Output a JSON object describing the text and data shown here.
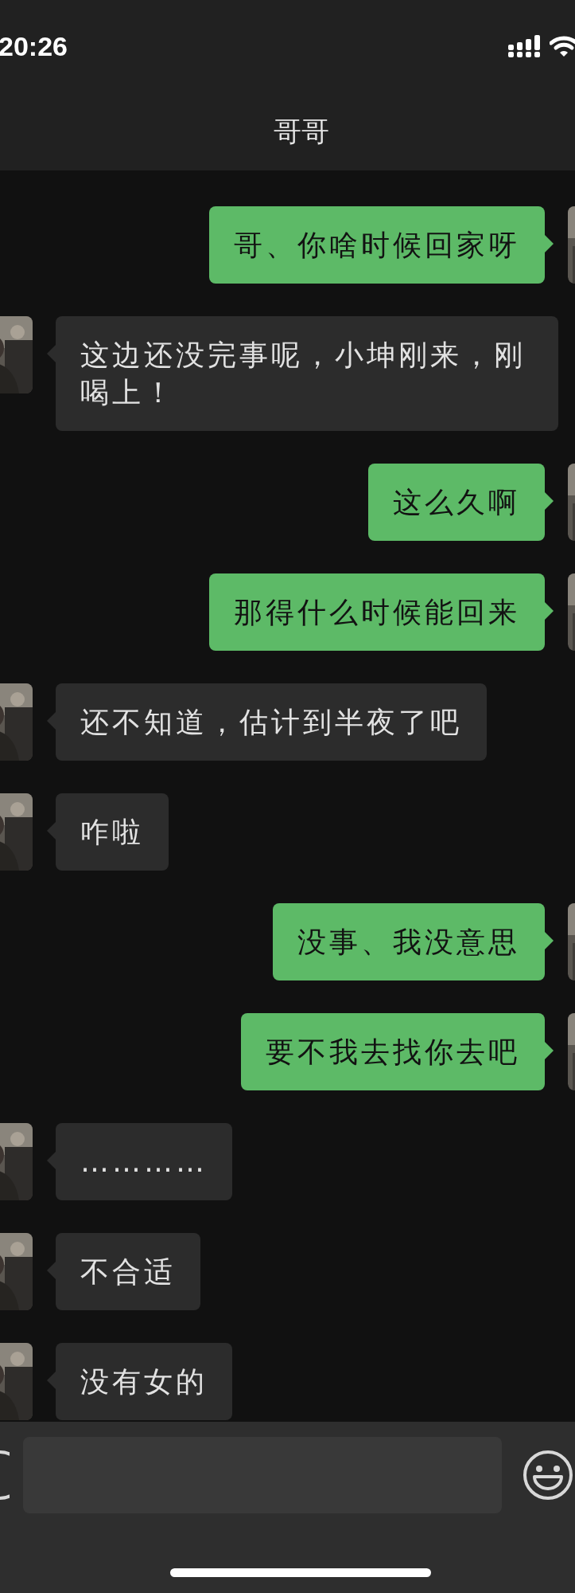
{
  "status_bar": {
    "time": "20:26"
  },
  "header": {
    "title": "哥哥"
  },
  "messages": [
    {
      "kind": "sent",
      "text": "哥、你啥时候回家呀"
    },
    {
      "kind": "received",
      "text": "这边还没完事呢，小坤刚来，刚喝上！"
    },
    {
      "kind": "sent",
      "text": "这么久啊"
    },
    {
      "kind": "sent",
      "text": "那得什么时候能回来"
    },
    {
      "kind": "received",
      "text": "还不知道，估计到半夜了吧"
    },
    {
      "kind": "received",
      "text": "咋啦"
    },
    {
      "kind": "sent",
      "text": "没事、我没意思"
    },
    {
      "kind": "sent",
      "text": "要不我去找你去吧"
    },
    {
      "kind": "received",
      "text": "…………"
    },
    {
      "kind": "received",
      "text": "不合适"
    },
    {
      "kind": "received",
      "text": "没有女的"
    }
  ]
}
